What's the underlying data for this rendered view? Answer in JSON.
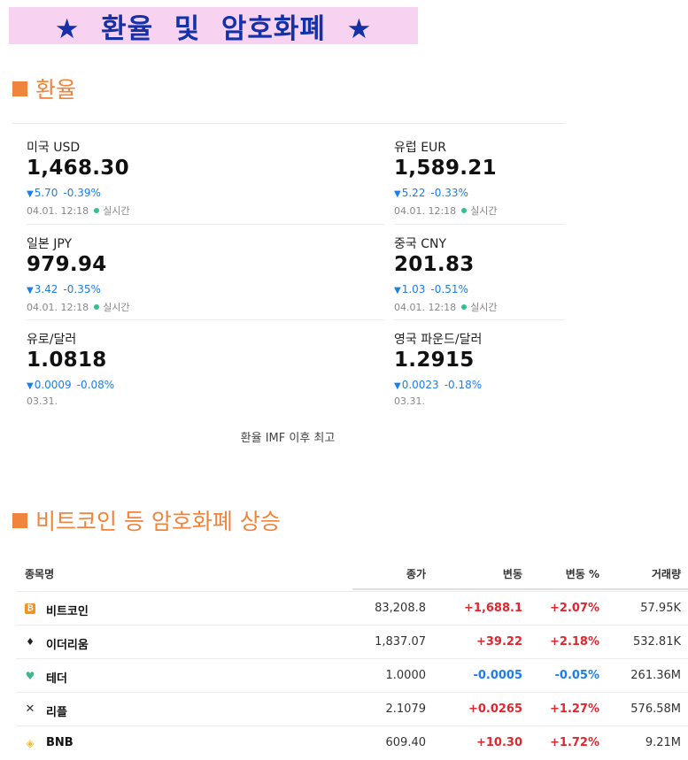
{
  "banner": {
    "title": "★  환율  및  암호화폐  ★"
  },
  "fx_section": {
    "title": "환율"
  },
  "fx": [
    {
      "name": "미국 USD",
      "value": "1,468.30",
      "change": "5.70",
      "pct": "-0.39%",
      "time": "04.01. 12:18",
      "live": "실시간"
    },
    {
      "name": "유럽 EUR",
      "value": "1,589.21",
      "change": "5.22",
      "pct": "-0.33%",
      "time": "04.01. 12:18",
      "live": "실시간"
    },
    {
      "name": "일본 JPY",
      "value": "979.94",
      "change": "3.42",
      "pct": "-0.35%",
      "time": "04.01. 12:18",
      "live": "실시간"
    },
    {
      "name": "중국 CNY",
      "value": "201.83",
      "change": "1.03",
      "pct": "-0.51%",
      "time": "04.01. 12:18",
      "live": "실시간"
    },
    {
      "name": "유로/달러",
      "value": "1.0818",
      "change": "0.0009",
      "pct": "-0.08%",
      "time": "03.31.",
      "live": ""
    },
    {
      "name": "영국 파운드/달러",
      "value": "1.2915",
      "change": "0.0023",
      "pct": "-0.18%",
      "time": "03.31.",
      "live": ""
    }
  ],
  "fx_footer": "환율 IMF 이후 최고",
  "crypto_section": {
    "title": "비트코인 등 암호화폐 상승"
  },
  "crypto_table": {
    "headers": {
      "name": "종목명",
      "price": "종가",
      "change": "변동",
      "pct": "변동 %",
      "volume": "거래량"
    },
    "rows": [
      {
        "icon": "bitcoin-icon",
        "name": "비트코인",
        "price": "83,208.8",
        "change": "+1,688.1",
        "pct": "+2.07%",
        "volume": "57.95K",
        "dir": "up"
      },
      {
        "icon": "ethereum-icon",
        "name": "이더리움",
        "price": "1,837.07",
        "change": "+39.22",
        "pct": "+2.18%",
        "volume": "532.81K",
        "dir": "up"
      },
      {
        "icon": "tether-icon",
        "name": "테더",
        "price": "1.0000",
        "change": "-0.0005",
        "pct": "-0.05%",
        "volume": "261.36M",
        "dir": "down"
      },
      {
        "icon": "xrp-icon",
        "name": "리플",
        "price": "2.1079",
        "change": "+0.0265",
        "pct": "+1.27%",
        "volume": "576.58M",
        "dir": "up"
      },
      {
        "icon": "bnb-icon",
        "name": "BNB",
        "price": "609.40",
        "change": "+10.30",
        "pct": "+1.72%",
        "volume": "9.21M",
        "dir": "up"
      }
    ]
  },
  "colors": {
    "accent_orange": "#f0843c",
    "banner_bg": "#f7d3f1",
    "banner_text": "#1431a8",
    "up": "#e0262e",
    "down": "#1e7ee8",
    "live_dot": "#2ec38e"
  }
}
